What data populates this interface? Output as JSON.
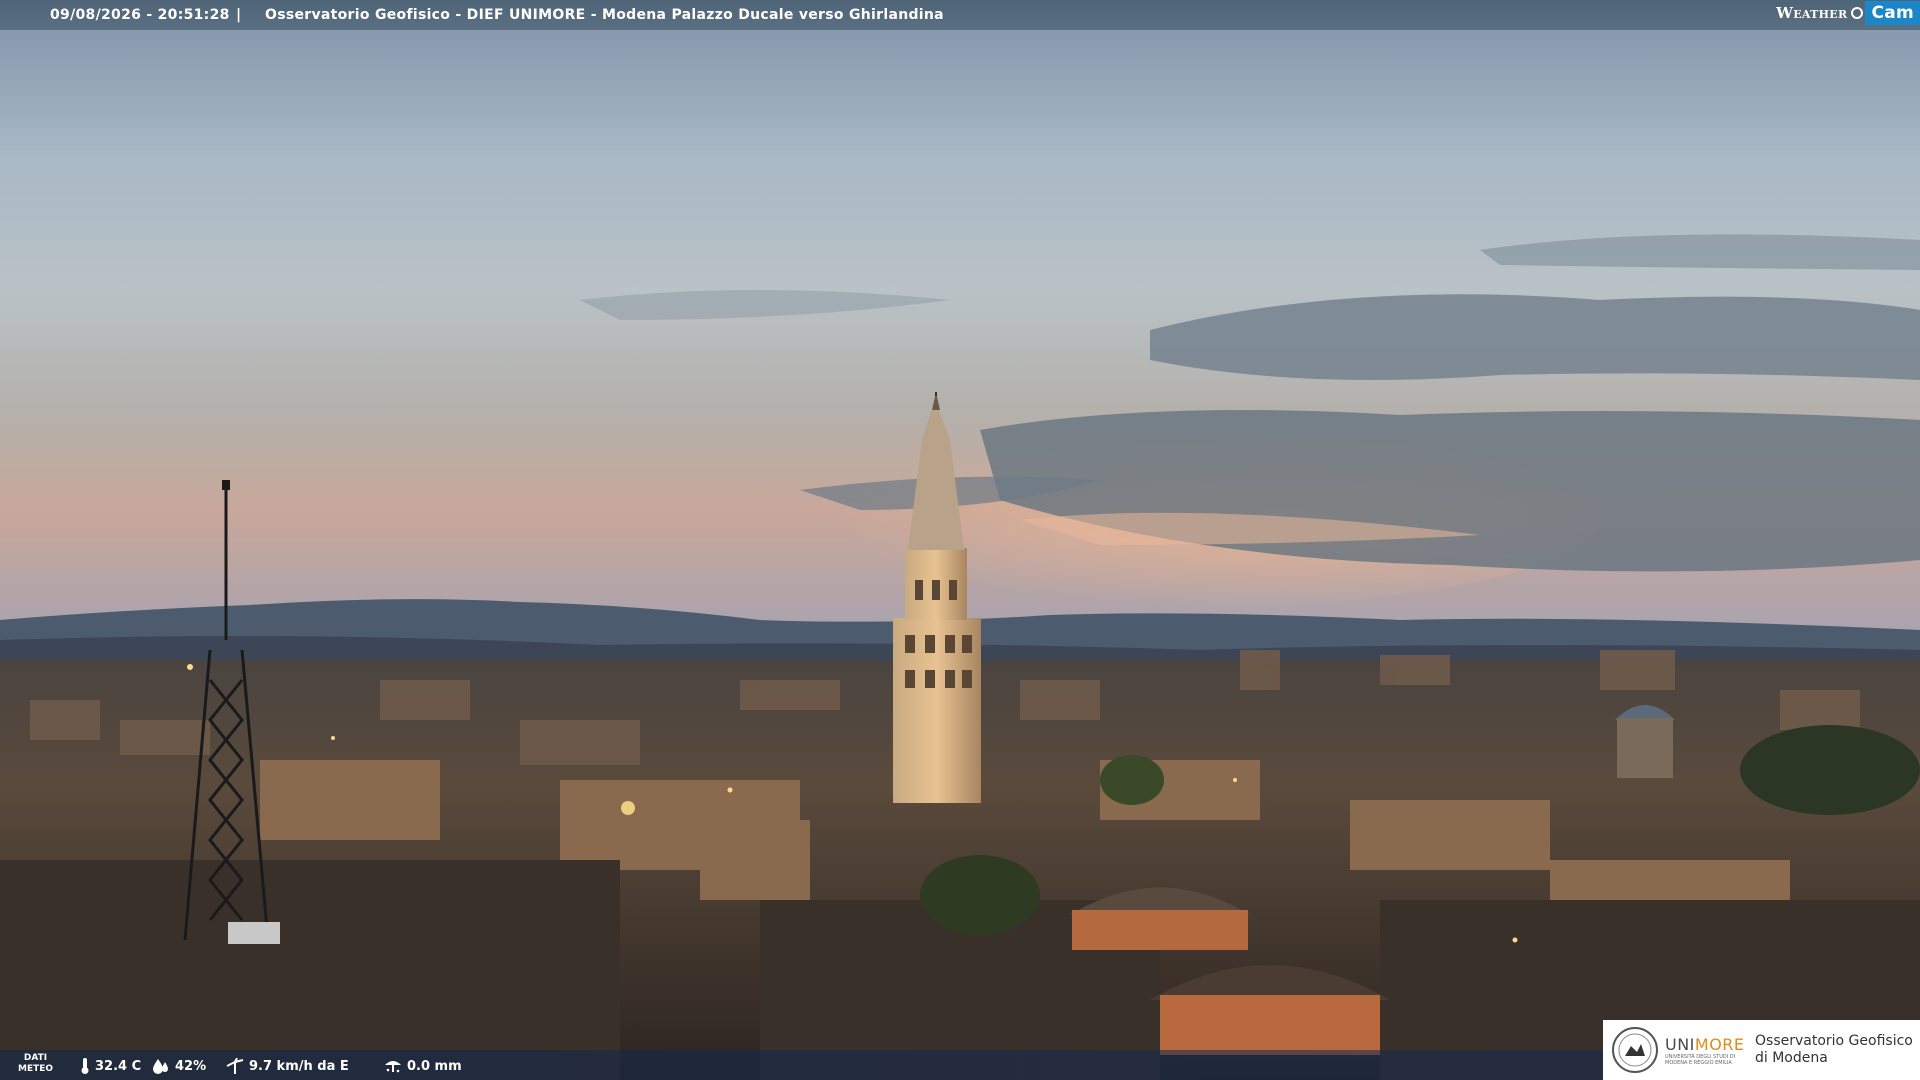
{
  "header": {
    "timestamp": "09/08/2026 - 20:51:28",
    "separator": "|",
    "title": "Osservatorio Geofisico - DIEF UNIMORE - Modena Palazzo Ducale verso Ghirlandina",
    "brand_weather": "Weather",
    "brand_cam": "Cam"
  },
  "weather": {
    "dati_label_1": "DATI",
    "dati_label_2": "METEO",
    "temperature": "32.4 C",
    "humidity": "42%",
    "wind": "9.7 km/h da E",
    "rain": "0.0 mm"
  },
  "logo": {
    "name_part1": "UNI",
    "name_part2": "MORE",
    "subtitle": "UNIVERSITÀ DEGLI STUDI DI MODENA E REGGIO EMILIA",
    "observatory_line1": "Osservatorio Geofisico",
    "observatory_line2": "di Modena",
    "accent_color": "#e08a1a"
  },
  "icons": [
    "thermometer-icon",
    "humidity-icon",
    "wind-icon",
    "rain-icon"
  ]
}
